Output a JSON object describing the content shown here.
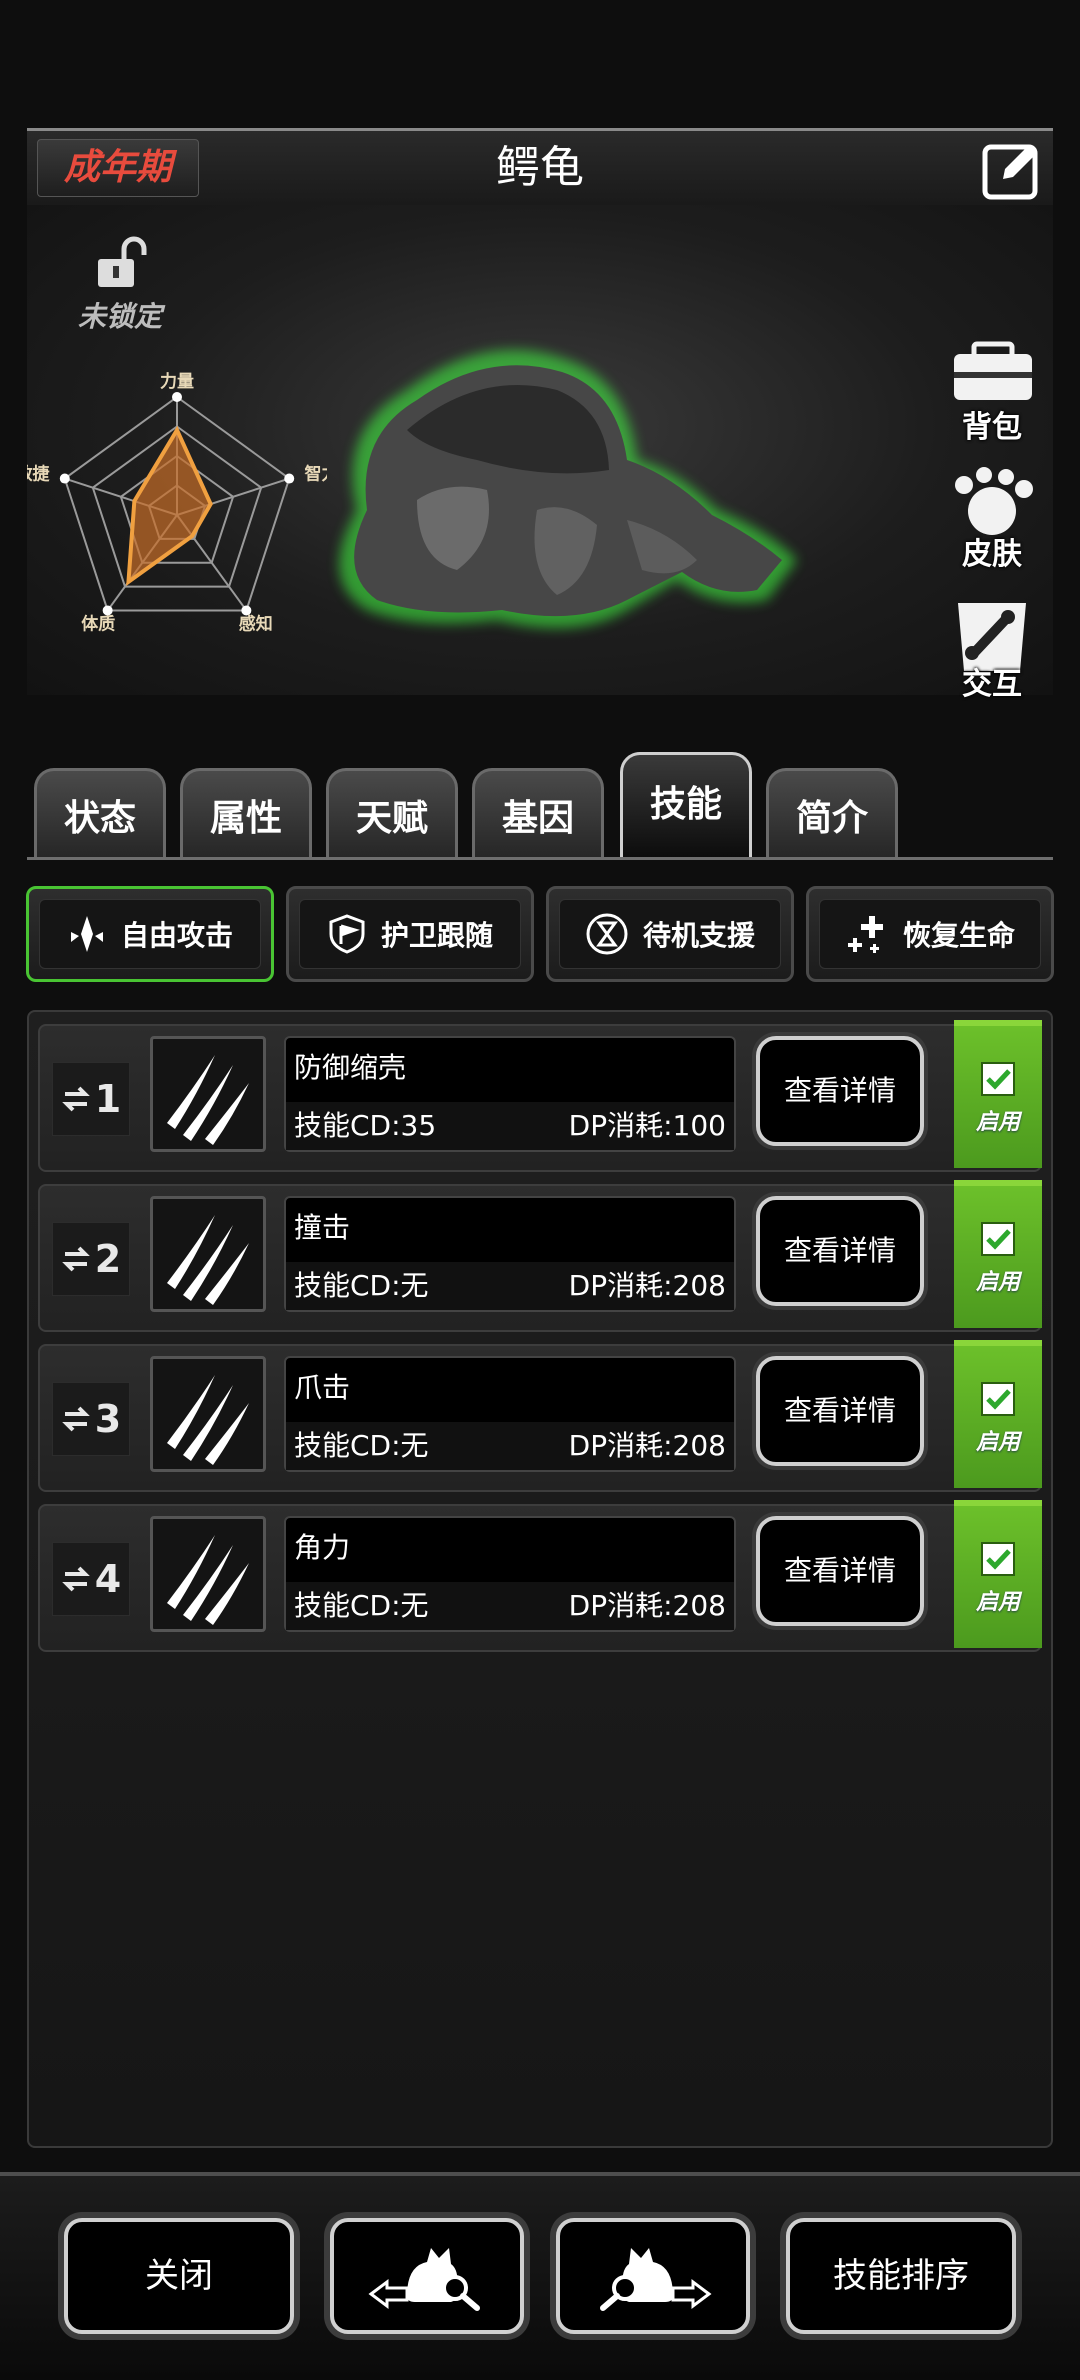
{
  "header": {
    "stage": "成年期",
    "title": "鳄龟"
  },
  "lock": {
    "label": "未锁定"
  },
  "radar": {
    "labels": [
      "力量",
      "智力",
      "感知",
      "体质",
      "敏捷"
    ],
    "values": [
      0.72,
      0.3,
      0.22,
      0.7,
      0.38
    ],
    "color": "#f0a040"
  },
  "side_buttons": [
    "背包",
    "皮肤",
    "交互"
  ],
  "tabs": [
    "状态",
    "属性",
    "天赋",
    "基因",
    "技能",
    "简介"
  ],
  "active_tab": "技能",
  "modes": [
    {
      "label": "自由攻击",
      "icon": "attack-icon",
      "active": true
    },
    {
      "label": "护卫跟随",
      "icon": "shield-flag-icon",
      "active": false
    },
    {
      "label": "待机支援",
      "icon": "hourglass-icon",
      "active": false
    },
    {
      "label": "恢复生命",
      "icon": "heal-cross-icon",
      "active": false
    }
  ],
  "skills": [
    {
      "slot": "1",
      "name": "防御缩壳",
      "cd": "技能CD:35",
      "dp": "DP消耗:100",
      "detail": "查看详情",
      "enabled_label": "启用",
      "enabled": true
    },
    {
      "slot": "2",
      "name": "撞击",
      "cd": "技能CD:无",
      "dp": "DP消耗:208",
      "detail": "查看详情",
      "enabled_label": "启用",
      "enabled": true
    },
    {
      "slot": "3",
      "name": "爪击",
      "cd": "技能CD:无",
      "dp": "DP消耗:208",
      "detail": "查看详情",
      "enabled_label": "启用",
      "enabled": true
    },
    {
      "slot": "4",
      "name": "角力",
      "cd": "技能CD:无",
      "dp": "DP消耗:208",
      "detail": "查看详情",
      "enabled_label": "启用",
      "enabled": true
    }
  ],
  "bottom": {
    "close": "关闭",
    "sort": "技能排序"
  },
  "colors": {
    "accent_green": "#49c433",
    "stage_red": "#e84b3d"
  }
}
